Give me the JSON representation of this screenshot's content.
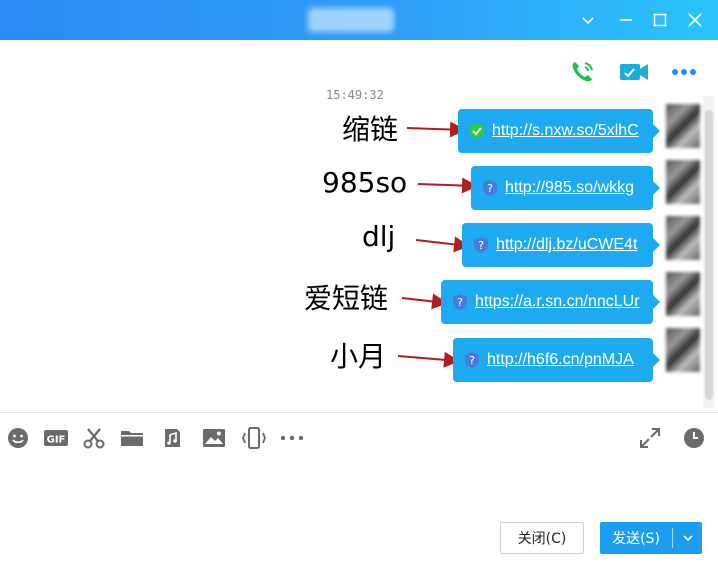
{
  "window": {
    "title": "",
    "controls": [
      "minimize-chevron",
      "minimize",
      "maximize",
      "close"
    ]
  },
  "header_icons": [
    "voice-call-icon",
    "video-call-icon",
    "more-icon"
  ],
  "chat": {
    "timestamp": "15:49:32",
    "messages": [
      {
        "label": "缩链",
        "url": "http://s.nxw.so/5xlhC",
        "status": "safe",
        "status_color": "#2ecc40"
      },
      {
        "label": "985so",
        "url": "http://985.so/wkkg",
        "status": "unknown",
        "status_color": "#4a7bd8"
      },
      {
        "label": "dlj",
        "url": "http://dlj.bz/uCWE4t",
        "status": "unknown",
        "status_color": "#4a7bd8"
      },
      {
        "label": "爱短链",
        "url": "https://a.r.sn.cn/nncLUr",
        "status": "unknown",
        "status_color": "#4a7bd8"
      },
      {
        "label": "小月",
        "url": "http://h6f6.cn/pnMJA",
        "status": "unknown",
        "status_color": "#4a7bd8"
      }
    ]
  },
  "toolbar": [
    "emoji-icon",
    "gif-icon",
    "scissors-icon",
    "folder-icon",
    "music-file-icon",
    "image-icon",
    "screen-shake-icon",
    "more-icon",
    "fullscreen-icon",
    "history-clock-icon"
  ],
  "toolbar_gif_text": "GIF",
  "buttons": {
    "close_label": "关闭(C)",
    "send_label": "发送(S)"
  },
  "colors": {
    "titlebar": "#2b8cf5",
    "bubble": "#1eaaf1",
    "arrow": "#b01e1e",
    "call_green": "#19c24a",
    "video_teal": "#1aaee0"
  }
}
